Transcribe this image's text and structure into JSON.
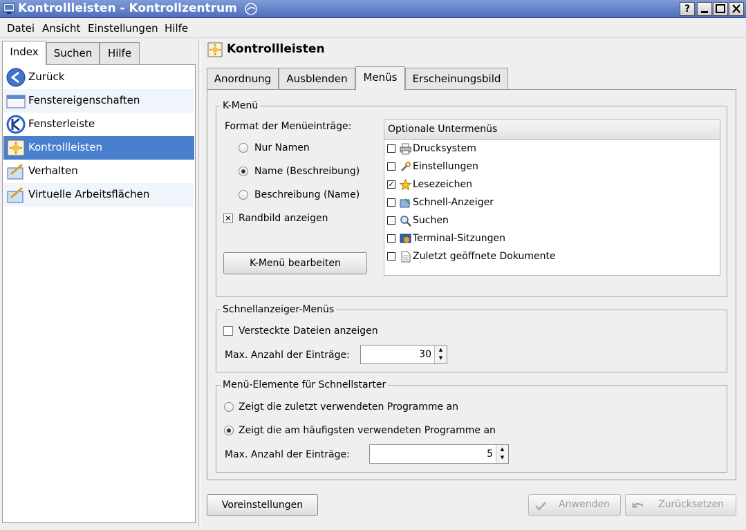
{
  "window": {
    "title": "Kontrollleisten - Kontrollzentrum",
    "help_btn": "?"
  },
  "menubar": [
    {
      "label": "Datei"
    },
    {
      "label": "Ansicht"
    },
    {
      "label": "Einstellungen"
    },
    {
      "label": "Hilfe"
    }
  ],
  "left_tabs": [
    {
      "label": "Index",
      "active": true
    },
    {
      "label": "Suchen"
    },
    {
      "label": "Hilfe"
    }
  ],
  "nav_items": [
    {
      "label": "Zurück",
      "icon": "back-arrow-icon"
    },
    {
      "label": "Fenstereigenschaften",
      "icon": "window-properties-icon"
    },
    {
      "label": "Fensterleiste",
      "icon": "kde-logo-icon"
    },
    {
      "label": "Kontrollleisten",
      "icon": "panel-icon",
      "selected": true
    },
    {
      "label": "Verhalten",
      "icon": "behavior-icon"
    },
    {
      "label": "Virtuelle Arbeitsflächen",
      "icon": "virtual-desktops-icon"
    }
  ],
  "page": {
    "title": "Kontrollleisten"
  },
  "tabs": [
    {
      "label": "Anordnung"
    },
    {
      "label": "Ausblenden"
    },
    {
      "label": "Menüs",
      "active": true
    },
    {
      "label": "Erscheinungsbild"
    }
  ],
  "kmenu": {
    "group_title": "K-Menü",
    "format_label": "Format der Menüeinträge:",
    "radio_options": [
      {
        "label": "Nur Namen",
        "checked": false
      },
      {
        "label": "Name (Beschreibung)",
        "checked": true
      },
      {
        "label": "Beschreibung (Name)",
        "checked": false
      }
    ],
    "sidebar_checkbox": {
      "label": "Randbild anzeigen",
      "checked": true
    },
    "edit_button": "K-Menü bearbeiten",
    "submenus_header": "Optionale Untermenüs",
    "submenus": [
      {
        "label": "Drucksystem",
        "checked": false,
        "icon": "printer-icon"
      },
      {
        "label": "Einstellungen",
        "checked": false,
        "icon": "wrench-icon"
      },
      {
        "label": "Lesezeichen",
        "checked": true,
        "icon": "star-icon"
      },
      {
        "label": "Schnell-Anzeiger",
        "checked": false,
        "icon": "quickbrowser-icon"
      },
      {
        "label": "Suchen",
        "checked": false,
        "icon": "magnifier-icon"
      },
      {
        "label": "Terminal-Sitzungen",
        "checked": false,
        "icon": "terminal-icon"
      },
      {
        "label": "Zuletzt geöffnete Dokumente",
        "checked": false,
        "icon": "document-icon"
      }
    ]
  },
  "quickbrowser": {
    "group_title": "Schnellanzeiger-Menüs",
    "hidden_files": {
      "label": "Versteckte Dateien anzeigen",
      "checked": false
    },
    "max_label": "Max. Anzahl der Einträge:",
    "max_value": "30"
  },
  "quickstart": {
    "group_title": "Menü-Elemente für Schnellstarter",
    "radio_options": [
      {
        "label": "Zeigt die zuletzt verwendeten Programme an",
        "checked": false
      },
      {
        "label": "Zeigt die am häufigsten verwendeten Programme an",
        "checked": true
      }
    ],
    "max_label": "Max. Anzahl der Einträge:",
    "max_value": "5"
  },
  "footer": {
    "defaults": "Voreinstellungen",
    "apply": "Anwenden",
    "reset": "Zurücksetzen"
  }
}
